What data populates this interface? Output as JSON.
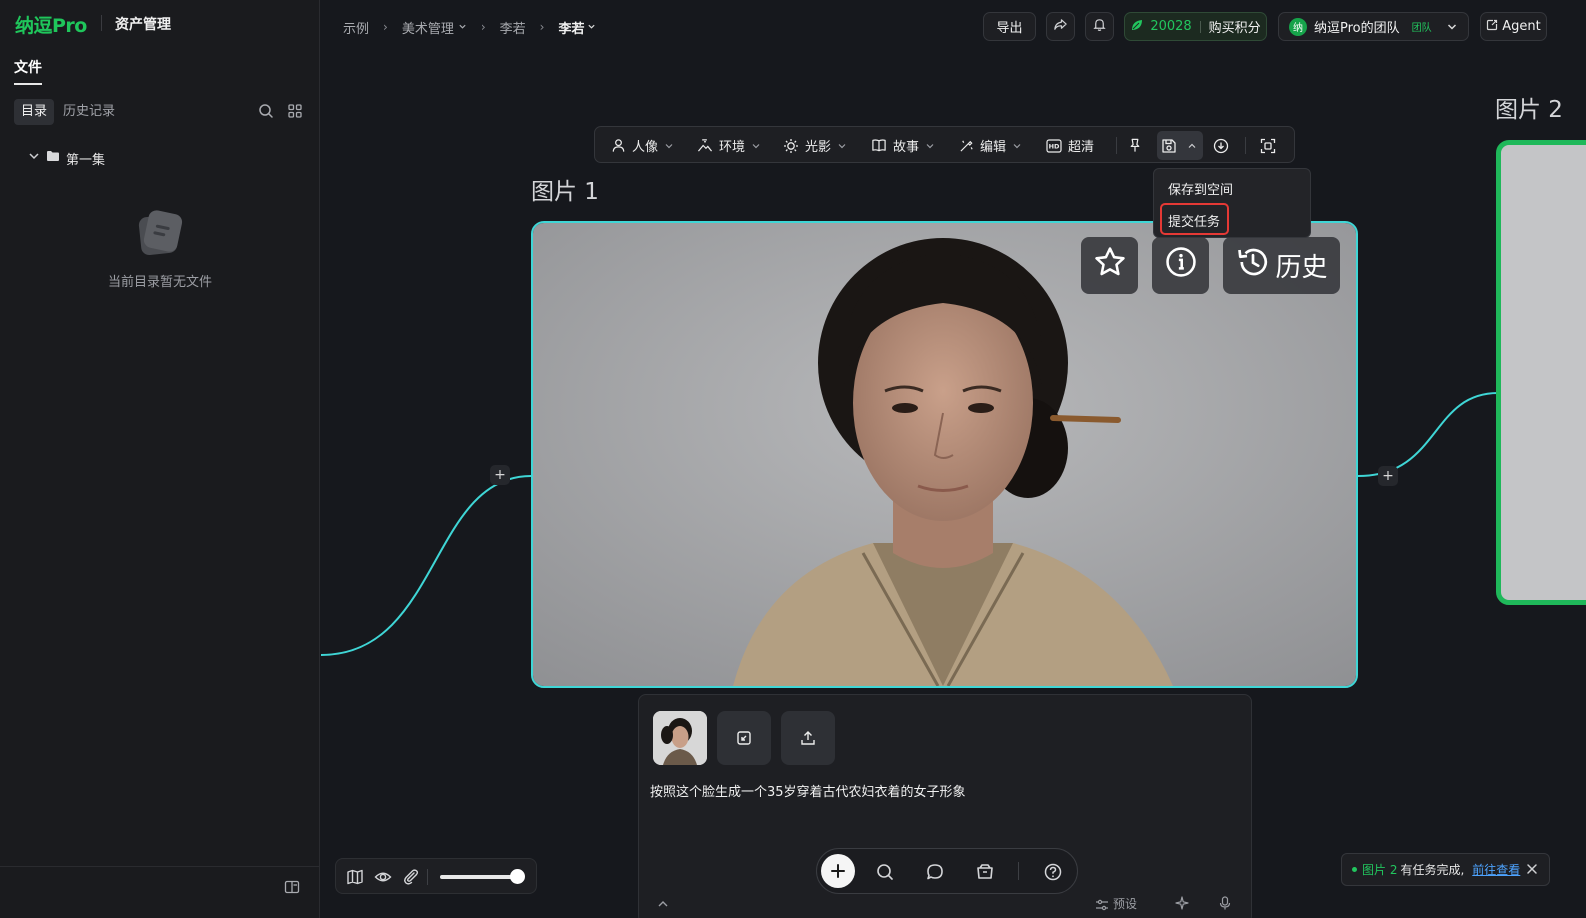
{
  "app": {
    "logo": "纳逗Pro",
    "title": "资产管理"
  },
  "sidebar": {
    "files_tab": "文件",
    "tabs": [
      "目录",
      "历史记录"
    ],
    "folder": "第一集",
    "empty_text": "当前目录暂无文件"
  },
  "breadcrumb": {
    "items": [
      "示例",
      "美术管理",
      "李若",
      "李若"
    ]
  },
  "header": {
    "export_label": "导出",
    "points": "20028",
    "buy_points_label": "购买积分",
    "team_name": "纳逗Pro的团队",
    "team_badge": "团队",
    "agent_label": "Agent"
  },
  "toolbar": {
    "items": [
      "人像",
      "环境",
      "光影",
      "故事",
      "编辑",
      "超清"
    ]
  },
  "dropdown": {
    "items": [
      "保存到空间",
      "提交任务"
    ]
  },
  "canvas": {
    "image1_label": "图片 1",
    "image2_label": "图片 2",
    "history_label": "历史"
  },
  "prompt": {
    "text": "按照这个脸生成一个35岁穿着古代农妇衣着的女子形象",
    "preset_label": "预设"
  },
  "toast": {
    "image_ref": "图片 2",
    "message": "有任务完成,",
    "link_label": "前往查看"
  },
  "colors": {
    "brand_green": "#1fc65b",
    "accent_cyan": "#3fd6d6",
    "highlight_red": "#e53935",
    "link_blue": "#4da3ff"
  }
}
